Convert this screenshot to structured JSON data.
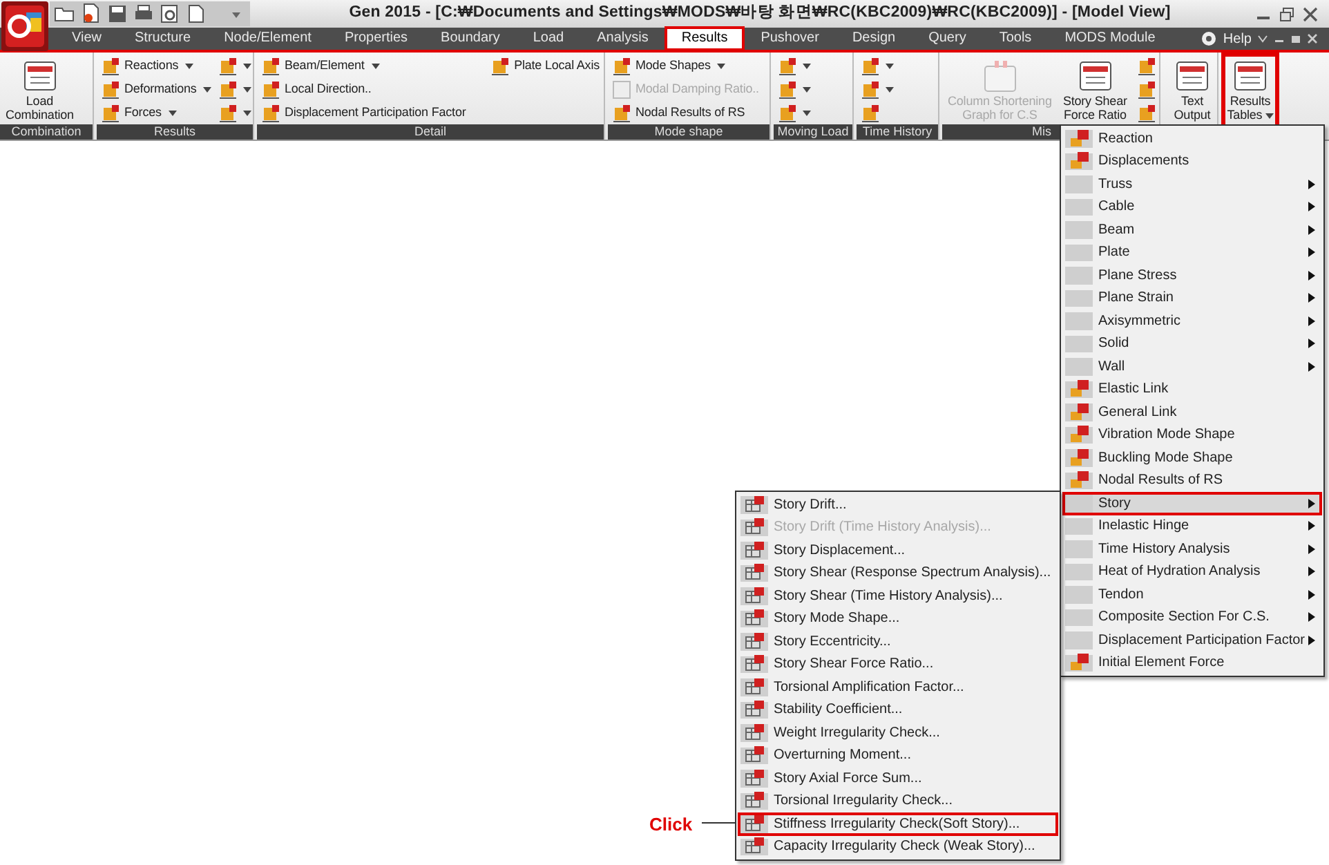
{
  "window": {
    "title": "Gen 2015 - [C:₩Documents and Settings₩MODS₩바탕 화면₩RC(KBC2009)₩RC(KBC2009)] - [Model View]"
  },
  "tabs": [
    {
      "label": "View",
      "selected": false
    },
    {
      "label": "Structure",
      "selected": false
    },
    {
      "label": "Node/Element",
      "selected": false
    },
    {
      "label": "Properties",
      "selected": false
    },
    {
      "label": "Boundary",
      "selected": false
    },
    {
      "label": "Load",
      "selected": false
    },
    {
      "label": "Analysis",
      "selected": false
    },
    {
      "label": "Results",
      "selected": true
    },
    {
      "label": "Pushover",
      "selected": false
    },
    {
      "label": "Design",
      "selected": false
    },
    {
      "label": "Query",
      "selected": false
    },
    {
      "label": "Tools",
      "selected": false
    },
    {
      "label": "MODS Module",
      "selected": false
    }
  ],
  "help": {
    "label": "Help"
  },
  "ribbon_groups": [
    {
      "label": "Combination",
      "highlighted": false,
      "columns": [
        [
          {
            "kind": "large",
            "lines": [
              "Load",
              "Combination"
            ],
            "disabled": false,
            "dropdown": false
          }
        ]
      ]
    },
    {
      "label": "Results",
      "highlighted": false,
      "columns": [
        [
          {
            "kind": "small",
            "label": "Reactions",
            "disabled": false,
            "dropdown": true
          },
          {
            "kind": "small",
            "label": "Deformations",
            "disabled": false,
            "dropdown": true
          },
          {
            "kind": "small",
            "label": "Forces",
            "disabled": false,
            "dropdown": true
          }
        ],
        [
          {
            "kind": "icon",
            "disabled": false,
            "dropdown": true
          },
          {
            "kind": "icon",
            "disabled": false,
            "dropdown": true
          },
          {
            "kind": "icon",
            "disabled": false,
            "dropdown": true
          }
        ]
      ]
    },
    {
      "label": "Detail",
      "highlighted": false,
      "columns": [
        [
          {
            "kind": "small",
            "label": "Beam/Element",
            "disabled": false,
            "dropdown": true
          },
          {
            "kind": "small",
            "label": "Local Direction..",
            "disabled": false,
            "dropdown": false
          },
          {
            "kind": "small",
            "label": "Displacement Participation Factor",
            "disabled": false,
            "dropdown": false
          }
        ],
        [
          {
            "kind": "small",
            "label": "Plate Local Axis",
            "disabled": false,
            "dropdown": false
          }
        ]
      ]
    },
    {
      "label": "Mode shape",
      "highlighted": false,
      "columns": [
        [
          {
            "kind": "small",
            "label": "Mode Shapes",
            "disabled": false,
            "dropdown": true
          },
          {
            "kind": "small",
            "label": "Modal Damping Ratio..",
            "disabled": true,
            "dropdown": false
          },
          {
            "kind": "small",
            "label": "Nodal Results of RS",
            "disabled": false,
            "dropdown": false
          }
        ]
      ]
    },
    {
      "label": "Moving Load",
      "highlighted": false,
      "columns": [
        [
          {
            "kind": "icon",
            "disabled": false,
            "dropdown": true
          },
          {
            "kind": "icon",
            "disabled": false,
            "dropdown": true
          },
          {
            "kind": "icon",
            "disabled": false,
            "dropdown": true
          }
        ]
      ]
    },
    {
      "label": "Time History",
      "highlighted": false,
      "columns": [
        [
          {
            "kind": "icon",
            "disabled": false,
            "dropdown": true
          },
          {
            "kind": "icon",
            "disabled": false,
            "dropdown": true
          },
          {
            "kind": "icon",
            "disabled": false,
            "dropdown": false
          }
        ]
      ]
    },
    {
      "label": "Mis",
      "highlighted": false,
      "columns": [
        [
          {
            "kind": "large",
            "lines": [
              "Column Shortening",
              "Graph for C.S"
            ],
            "disabled": true,
            "dropdown": false
          }
        ],
        [
          {
            "kind": "large",
            "lines": [
              "Story Shear",
              "Force Ratio"
            ],
            "disabled": false,
            "dropdown": false
          }
        ],
        [
          {
            "kind": "icon",
            "disabled": false,
            "dropdown": false
          },
          {
            "kind": "icon",
            "disabled": false,
            "dropdown": false
          },
          {
            "kind": "icon",
            "disabled": false,
            "dropdown": false
          }
        ]
      ]
    },
    {
      "highlighted": false,
      "columns": [
        [
          {
            "kind": "large",
            "lines": [
              "Text",
              "Output"
            ],
            "disabled": false,
            "dropdown": false
          }
        ]
      ]
    },
    {
      "highlighted": true,
      "columns": [
        [
          {
            "kind": "large",
            "lines": [
              "Results",
              "Tables"
            ],
            "disabled": false,
            "dropdown": true
          }
        ]
      ]
    }
  ],
  "results_menu": [
    {
      "label": "Reaction",
      "icon": true,
      "submenu": false,
      "disabled": false,
      "selected": false
    },
    {
      "label": "Displacements",
      "icon": true,
      "submenu": false,
      "disabled": false,
      "selected": false
    },
    {
      "label": "Truss",
      "icon": false,
      "submenu": true,
      "disabled": false,
      "selected": false
    },
    {
      "label": "Cable",
      "icon": false,
      "submenu": true,
      "disabled": false,
      "selected": false
    },
    {
      "label": "Beam",
      "icon": false,
      "submenu": true,
      "disabled": false,
      "selected": false
    },
    {
      "label": "Plate",
      "icon": false,
      "submenu": true,
      "disabled": false,
      "selected": false
    },
    {
      "label": "Plane Stress",
      "icon": false,
      "submenu": true,
      "disabled": false,
      "selected": false
    },
    {
      "label": "Plane Strain",
      "icon": false,
      "submenu": true,
      "disabled": false,
      "selected": false
    },
    {
      "label": "Axisymmetric",
      "icon": false,
      "submenu": true,
      "disabled": false,
      "selected": false
    },
    {
      "label": "Solid",
      "icon": false,
      "submenu": true,
      "disabled": false,
      "selected": false
    },
    {
      "label": "Wall",
      "icon": false,
      "submenu": true,
      "disabled": false,
      "selected": false
    },
    {
      "label": "Elastic Link",
      "icon": true,
      "submenu": false,
      "disabled": false,
      "selected": false
    },
    {
      "label": "General Link",
      "icon": true,
      "submenu": false,
      "disabled": false,
      "selected": false
    },
    {
      "label": "Vibration Mode Shape",
      "icon": true,
      "submenu": false,
      "disabled": false,
      "selected": false
    },
    {
      "label": "Buckling Mode Shape",
      "icon": true,
      "submenu": false,
      "disabled": false,
      "selected": false
    },
    {
      "label": "Nodal Results of RS",
      "icon": true,
      "submenu": false,
      "disabled": false,
      "selected": false
    },
    {
      "label": "Story",
      "icon": false,
      "submenu": true,
      "disabled": false,
      "selected": true
    },
    {
      "label": "Inelastic Hinge",
      "icon": false,
      "submenu": true,
      "disabled": false,
      "selected": false
    },
    {
      "label": "Time History Analysis",
      "icon": false,
      "submenu": true,
      "disabled": false,
      "selected": false
    },
    {
      "label": "Heat of Hydration Analysis",
      "icon": false,
      "submenu": true,
      "disabled": false,
      "selected": false
    },
    {
      "label": "Tendon",
      "icon": false,
      "submenu": true,
      "disabled": false,
      "selected": false
    },
    {
      "label": "Composite Section For C.S.",
      "icon": false,
      "submenu": true,
      "disabled": false,
      "selected": false
    },
    {
      "label": "Displacement Participation Factor",
      "icon": false,
      "submenu": true,
      "disabled": false,
      "selected": false
    },
    {
      "label": "Initial Element Force",
      "icon": true,
      "submenu": false,
      "disabled": false,
      "selected": false
    }
  ],
  "story_menu": [
    {
      "label": "Story Drift...",
      "icon": true,
      "submenu": false,
      "disabled": false,
      "selected": false
    },
    {
      "label": "Story Drift (Time History Analysis)...",
      "icon": true,
      "submenu": false,
      "disabled": true,
      "selected": false
    },
    {
      "label": "Story Displacement...",
      "icon": true,
      "submenu": false,
      "disabled": false,
      "selected": false
    },
    {
      "label": "Story Shear (Response Spectrum Analysis)...",
      "icon": true,
      "submenu": false,
      "disabled": false,
      "selected": false
    },
    {
      "label": "Story Shear (Time History Analysis)...",
      "icon": true,
      "submenu": false,
      "disabled": false,
      "selected": false
    },
    {
      "label": "Story Mode Shape...",
      "icon": true,
      "submenu": false,
      "disabled": false,
      "selected": false
    },
    {
      "label": "Story Eccentricity...",
      "icon": true,
      "submenu": false,
      "disabled": false,
      "selected": false
    },
    {
      "label": "Story Shear Force Ratio...",
      "icon": true,
      "submenu": false,
      "disabled": false,
      "selected": false
    },
    {
      "label": "Torsional Amplification Factor...",
      "icon": true,
      "submenu": false,
      "disabled": false,
      "selected": false
    },
    {
      "label": "Stability Coefficient...",
      "icon": true,
      "submenu": false,
      "disabled": false,
      "selected": false
    },
    {
      "label": "Weight Irregularity Check...",
      "icon": true,
      "submenu": false,
      "disabled": false,
      "selected": false
    },
    {
      "label": "Overturning Moment...",
      "icon": true,
      "submenu": false,
      "disabled": false,
      "selected": false
    },
    {
      "label": "Story Axial Force Sum...",
      "icon": true,
      "submenu": false,
      "disabled": false,
      "selected": false
    },
    {
      "label": "Torsional Irregularity Check...",
      "icon": true,
      "submenu": false,
      "disabled": false,
      "selected": false
    },
    {
      "label": "Stiffness Irregularity Check(Soft Story)...",
      "icon": true,
      "submenu": false,
      "disabled": false,
      "selected": true
    },
    {
      "label": "Capacity Irregularity Check (Weak Story)...",
      "icon": true,
      "submenu": false,
      "disabled": false,
      "selected": false
    }
  ],
  "callout": {
    "text": "Click"
  }
}
